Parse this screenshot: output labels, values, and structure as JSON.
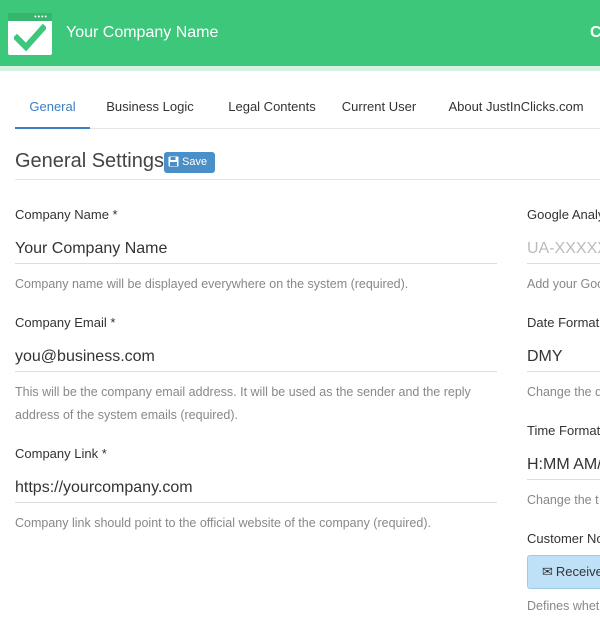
{
  "header": {
    "app_title": "Your Company Name",
    "right_text": "C",
    "bg_color": "#3cc77a",
    "logo_icon": "checkmark-calendar-icon"
  },
  "tabs": [
    {
      "label": "General",
      "active": true
    },
    {
      "label": "Business Logic",
      "active": false
    },
    {
      "label": "Legal Contents",
      "active": false
    },
    {
      "label": "Current User",
      "active": false
    },
    {
      "label": "About JustInClicks.com",
      "active": false
    }
  ],
  "section": {
    "title": "General Settings",
    "save_label": "Save",
    "save_icon": "floppy-disk-icon"
  },
  "left": {
    "company_name": {
      "label": "Company Name *",
      "value": "Your Company Name",
      "help": "Company name will be displayed everywhere on the system (required)."
    },
    "company_email": {
      "label": "Company Email *",
      "value": "you@business.com",
      "help": "This will be the company email address. It will be used as the sender and the reply address of the system emails (required)."
    },
    "company_link": {
      "label": "Company Link *",
      "value": "https://yourcompany.com",
      "help": "Company link should point to the official website of the company (required)."
    }
  },
  "right": {
    "google_analytics": {
      "label": "Google Analy",
      "placeholder": "UA-XXXXX",
      "help": "Add your Goo"
    },
    "date_format": {
      "label": "Date Format",
      "value": "DMY",
      "help": "Change the d"
    },
    "time_format": {
      "label": "Time Format",
      "value": "H:MM AM/",
      "help": "Change the t"
    },
    "customer_notifications": {
      "label": "Customer No",
      "button_label": "Receive",
      "button_icon": "envelope-icon",
      "help": "Defines whet"
    }
  }
}
